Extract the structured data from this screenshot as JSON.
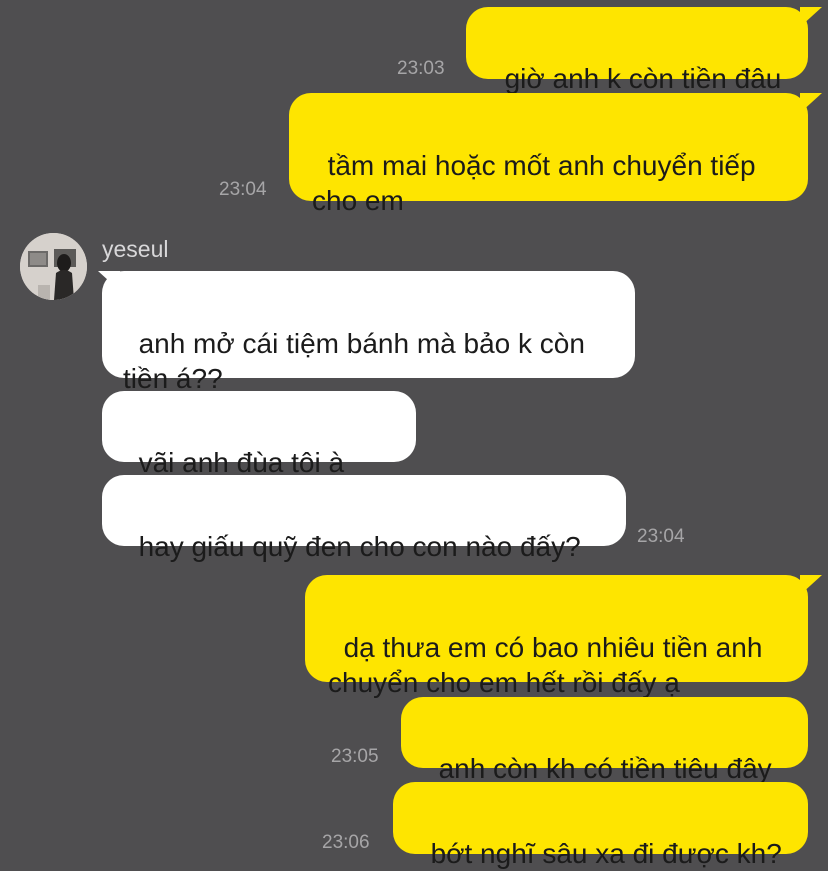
{
  "contact": {
    "name": "yeseul"
  },
  "messages": {
    "m1": {
      "text": "giờ anh k còn tiền đâu",
      "time": "23:03"
    },
    "m2": {
      "text": "tầm mai hoặc mốt anh chuyển tiếp\ncho em",
      "time": "23:04"
    },
    "m3": {
      "text": "anh mở cái tiệm bánh mà bảo k còn\ntiền á??"
    },
    "m4": {
      "text": "vãi anh đùa tôi à",
      "emoji": "grinning-face-emoji"
    },
    "m5": {
      "text": "hay giấu quỹ đen cho con nào đấy?",
      "time": "23:04"
    },
    "m6": {
      "text": "dạ thưa em có bao nhiêu tiền anh\nchuyển cho em hết rồi đấy ạ"
    },
    "m7": {
      "text": "anh còn kh có tiền tiêu đây",
      "time": "23:05"
    },
    "m8": {
      "text": "bớt nghĩ sâu xa đi được kh?",
      "time": "23:06"
    }
  },
  "colors": {
    "background": "#4f4e50",
    "my_bubble": "#fee500",
    "their_bubble": "#ffffff",
    "timestamp": "#a6a5a7"
  }
}
